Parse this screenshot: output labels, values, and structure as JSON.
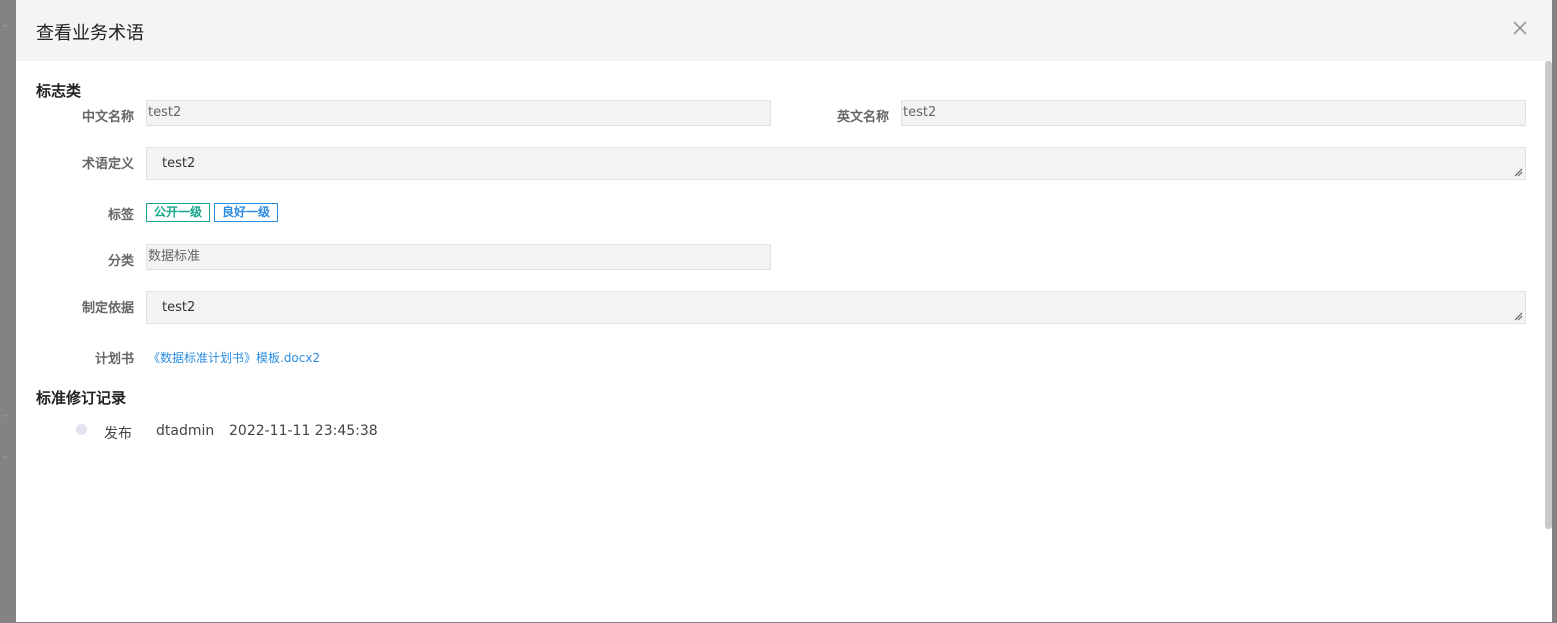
{
  "modal": {
    "title": "查看业务术语"
  },
  "sections": {
    "flag_title": "标志类",
    "revision_title": "标准修订记录"
  },
  "form": {
    "cn_name": {
      "label": "中文名称",
      "value": "test2"
    },
    "en_name": {
      "label": "英文名称",
      "value": "test2"
    },
    "definition": {
      "label": "术语定义",
      "value": "test2"
    },
    "tags": {
      "label": "标签",
      "items": [
        {
          "text": "公开一级",
          "color": "#18a78d"
        },
        {
          "text": "良好一级",
          "color": "#2b8de0"
        }
      ]
    },
    "category": {
      "label": "分类",
      "value": "数据标准"
    },
    "basis": {
      "label": "制定依据",
      "value": "test2"
    },
    "plan": {
      "label": "计划书",
      "link_text": "《数据标准计划书》模板.docx2"
    }
  },
  "revisions": [
    {
      "action": "发布",
      "user": "dtadmin",
      "time": "2022-11-11 23:45:38"
    }
  ],
  "icons": {
    "close": "close-icon",
    "resize": "resize-handle-icon"
  },
  "colors": {
    "accent_blue": "#2b8de0",
    "tag_green": "#18a78d",
    "header_bg": "#f4f4f4",
    "overlay": "#7f7f7f"
  }
}
